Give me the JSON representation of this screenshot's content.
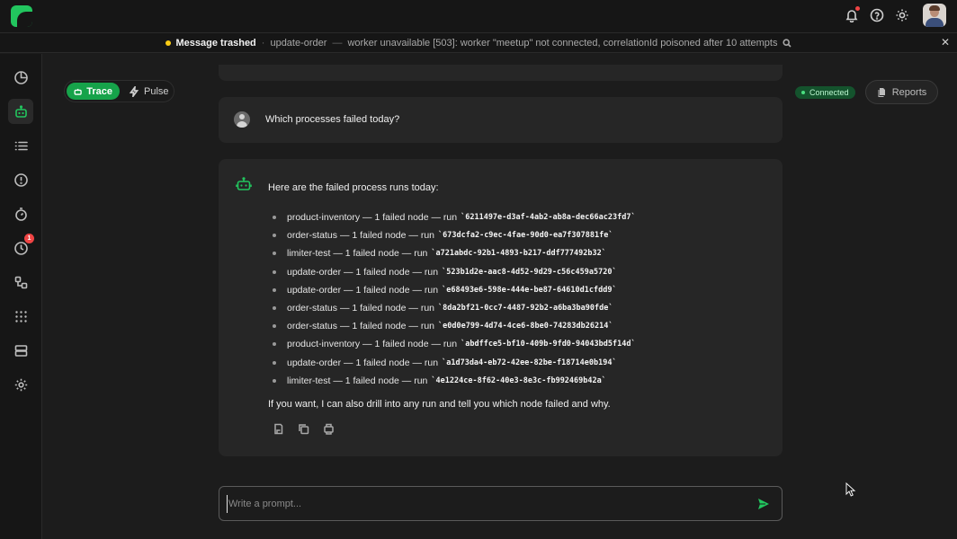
{
  "notification": {
    "title": "Message trashed",
    "process": "update-order",
    "detail": "worker unavailable [503]: worker \"meetup\" not connected, correlationId poisoned after 10 attempts"
  },
  "mode_toggle": {
    "active": "Trace",
    "inactive": "Pulse"
  },
  "status": {
    "connection": "Connected",
    "reports_label": "Reports"
  },
  "sidebar": {
    "alerts_badge": "1"
  },
  "conversation": {
    "user_message": "Which processes failed today?",
    "bot_intro": "Here are the failed process runs today:",
    "runs": [
      {
        "text": "product-inventory — 1 failed node — run",
        "id": "`6211497e-d3af-4ab2-ab8a-dec66ac23fd7`"
      },
      {
        "text": "order-status — 1 failed node — run",
        "id": "`673dcfa2-c9ec-4fae-90d0-ea7f307881fe`"
      },
      {
        "text": "limiter-test — 1 failed node — run",
        "id": "`a721abdc-92b1-4893-b217-ddf777492b32`"
      },
      {
        "text": "update-order — 1 failed node — run",
        "id": "`523b1d2e-aac8-4d52-9d29-c56c459a5720`"
      },
      {
        "text": "update-order — 1 failed node — run",
        "id": "`e68493e6-598e-444e-be87-64610d1cfdd9`"
      },
      {
        "text": "order-status — 1 failed node — run",
        "id": "`8da2bf21-0cc7-4487-92b2-a6ba3ba90fde`"
      },
      {
        "text": "order-status — 1 failed node — run",
        "id": "`e0d0e799-4d74-4ce6-8be0-74283db26214`"
      },
      {
        "text": "product-inventory — 1 failed node — run",
        "id": "`abdffce5-bf10-409b-9fd0-94043bd5f14d`"
      },
      {
        "text": "update-order — 1 failed node — run",
        "id": "`a1d73da4-eb72-42ee-82be-f18714e0b194`"
      },
      {
        "text": "limiter-test — 1 failed node — run",
        "id": "`4e1224ce-8f62-40e3-8e3c-fb992469b42a`"
      }
    ],
    "bot_outro": "If you want, I can also drill into any run and tell you which node failed and why."
  },
  "prompt": {
    "placeholder": "Write a prompt..."
  },
  "colors": {
    "accent": "#22c55e",
    "background": "#1c1c1c",
    "card": "#262626"
  }
}
